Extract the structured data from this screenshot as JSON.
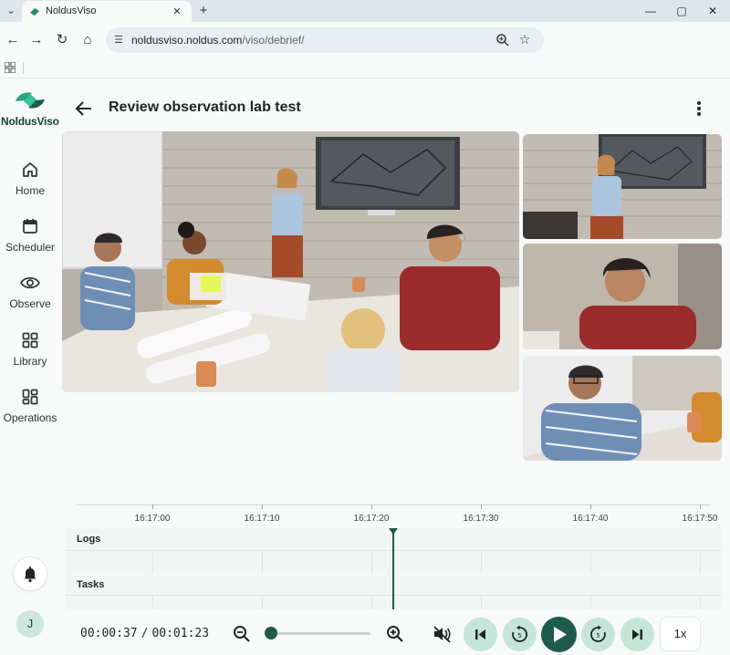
{
  "browser": {
    "tab_title": "NoldusViso",
    "url_host": "noldusviso.noldus.com",
    "url_path": "/viso/debrief/",
    "icons": [
      "tab-list-icon",
      "close-icon",
      "plus-icon",
      "minimize-icon",
      "maximize-icon",
      "close-window-icon",
      "back-icon",
      "forward-icon",
      "reload-icon",
      "home-icon",
      "site-settings-icon",
      "zoom-icon",
      "star-icon",
      "apps-icon"
    ]
  },
  "app": {
    "brand": "NoldusViso",
    "accent": "#1e5b4b",
    "accent_light": "#c5e5d8",
    "nav": [
      {
        "label": "Home",
        "icon": "home-icon"
      },
      {
        "label": "Scheduler",
        "icon": "calendar-icon"
      },
      {
        "label": "Observe",
        "icon": "eye-icon"
      },
      {
        "label": "Library",
        "icon": "grid-icon"
      },
      {
        "label": "Operations",
        "icon": "dashboard-icon"
      }
    ],
    "avatar_initial": "J"
  },
  "header": {
    "title": "Review observation lab test"
  },
  "timeline": {
    "ticks": [
      "16:17:00",
      "16:17:10",
      "16:17:20",
      "16:17:30",
      "16:17:40",
      "16:17:50"
    ],
    "tracks": [
      "Logs",
      "Tasks"
    ]
  },
  "player": {
    "current_time": "00:00:37",
    "total_time": "00:01:23",
    "speed": "1x",
    "zoom_level": 0.0,
    "muted": true
  }
}
